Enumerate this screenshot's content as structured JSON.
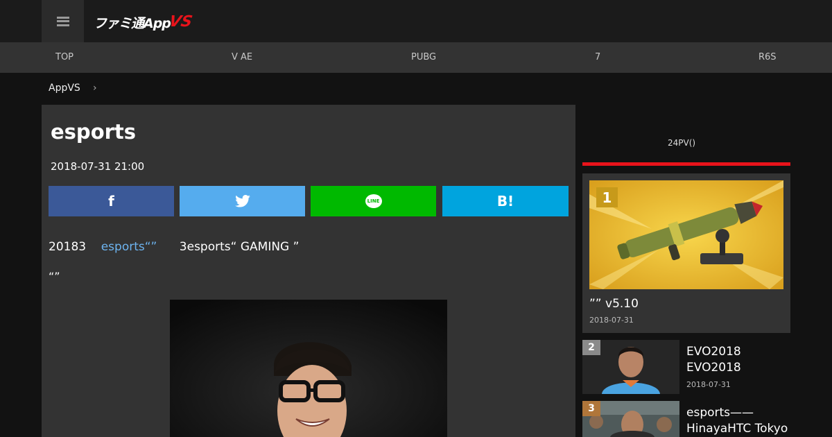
{
  "header": {
    "logo_text_main": "ファミ通App",
    "logo_text_accent": "VS"
  },
  "nav": {
    "items": [
      "TOP",
      "V AE",
      "PUBG",
      "7",
      "R6S"
    ]
  },
  "breadcrumb": {
    "home": "AppVS",
    "separator": "›"
  },
  "article": {
    "title": "esports",
    "date": "2018-07-31 21:00",
    "share": {
      "facebook_glyph": "f",
      "line_glyph": "LINE",
      "hatena_glyph": "B!"
    },
    "para1_a": "20183",
    "para1_link": "esports“”",
    "para1_b": "3esports“ GAMING ”",
    "para2": "“”"
  },
  "sidebar": {
    "title": "24PV()",
    "ranking": [
      {
        "rank": "1",
        "title": "”” v5.10",
        "date": "2018-07-31",
        "badge_color": "#c79a1a"
      },
      {
        "rank": "2",
        "title": "EVO2018 EVO2018",
        "date": "2018-07-31",
        "badge_color": "#8a8a8a"
      },
      {
        "rank": "3",
        "title": "esports—— HinayaHTC Tokyo",
        "date": "",
        "badge_color": "#b0763a"
      }
    ]
  },
  "colors": {
    "accent_red": "#e8131b",
    "facebook": "#3b5998",
    "twitter": "#55acee",
    "line": "#00b900",
    "hatena": "#00a4de"
  }
}
